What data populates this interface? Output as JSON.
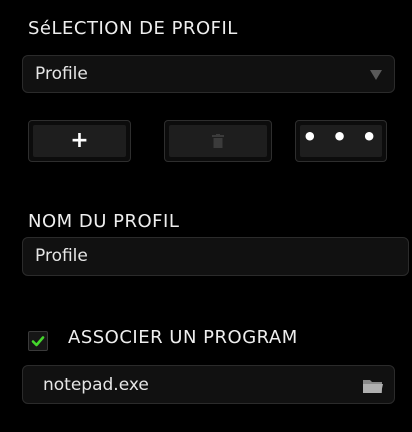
{
  "profile_selection": {
    "title": "SéLECTION DE PROFIL",
    "selected_profile": "Profile"
  },
  "actions": {
    "add_label": "+",
    "delete_icon": "trash-icon",
    "more_label": "• • •"
  },
  "profile_name": {
    "title": "NOM DU PROFIL",
    "value": "Profile"
  },
  "program_link": {
    "checked": true,
    "label": "ASSOCIER UN PROGRAM",
    "program": "notepad.exe",
    "browse_icon": "folder-icon"
  },
  "colors": {
    "accent": "#44d62c",
    "background": "#000000"
  }
}
